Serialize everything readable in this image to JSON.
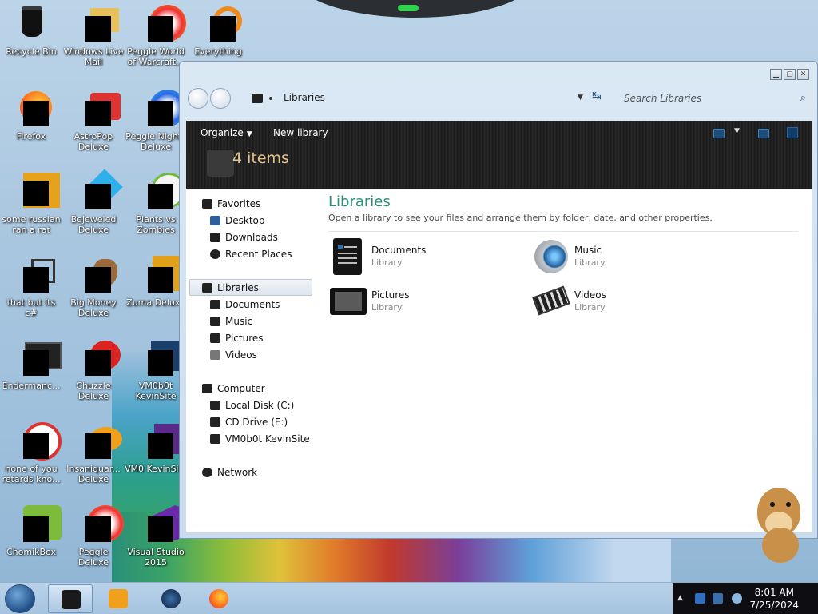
{
  "desktop": {
    "icons": [
      {
        "label": "Recycle Bin"
      },
      {
        "label": "Windows Live Mail"
      },
      {
        "label": "Peggle World of Warcraft..."
      },
      {
        "label": "Everything"
      },
      {
        "label": "Firefox"
      },
      {
        "label": "AstroPop Deluxe"
      },
      {
        "label": "Peggle Nights Deluxe"
      },
      {
        "label": "some russian ran a rat"
      },
      {
        "label": "Bejeweled Deluxe"
      },
      {
        "label": "Plants vs Zombies"
      },
      {
        "label": "that but its c#"
      },
      {
        "label": "Big Money Deluxe"
      },
      {
        "label": "Zuma Deluxe"
      },
      {
        "label": "Endermanc..."
      },
      {
        "label": "Chuzzle Deluxe"
      },
      {
        "label": "VM0b0t KevinSite"
      },
      {
        "label": "none of you retards kno..."
      },
      {
        "label": "Insaniquar... Deluxe"
      },
      {
        "label": "VM0 KevinSi..."
      },
      {
        "label": "ChomikBox"
      },
      {
        "label": "Peggle Deluxe"
      },
      {
        "label": "Visual Studio 2015"
      }
    ]
  },
  "window": {
    "address": {
      "crumb": "Libraries"
    },
    "search": {
      "placeholder": "Search Libraries"
    },
    "toolbar": {
      "organize_label": "Organize",
      "new_library_label": "New library",
      "item_count": "4 items"
    },
    "nav": {
      "favorites": "Favorites",
      "desktop": "Desktop",
      "downloads": "Downloads",
      "recent_places": "Recent Places",
      "libraries": "Libraries",
      "documents": "Documents",
      "music": "Music",
      "pictures": "Pictures",
      "videos": "Videos",
      "computer": "Computer",
      "local_disk": "Local Disk (C:)",
      "cd_drive": "CD Drive (E:)",
      "vm_site": "VM0b0t KevinSite",
      "network": "Network"
    },
    "main": {
      "title": "Libraries",
      "subtitle": "Open a library to see your files and arrange them by folder, date, and other properties.",
      "libraries": [
        {
          "name": "Documents",
          "type": "Library",
          "icon": "documents-library-icon"
        },
        {
          "name": "Music",
          "type": "Library",
          "icon": "music-library-icon"
        },
        {
          "name": "Pictures",
          "type": "Library",
          "icon": "pictures-library-icon"
        },
        {
          "name": "Videos",
          "type": "Library",
          "icon": "videos-library-icon"
        }
      ]
    }
  },
  "taskbar": {
    "clock_time": "8:01 AM",
    "clock_date": "7/25/2024"
  },
  "colors": {
    "accent_title": "#2a8f7a",
    "toolbar_bg": "#1c1c1c",
    "item_count_color": "#e3c48b"
  }
}
